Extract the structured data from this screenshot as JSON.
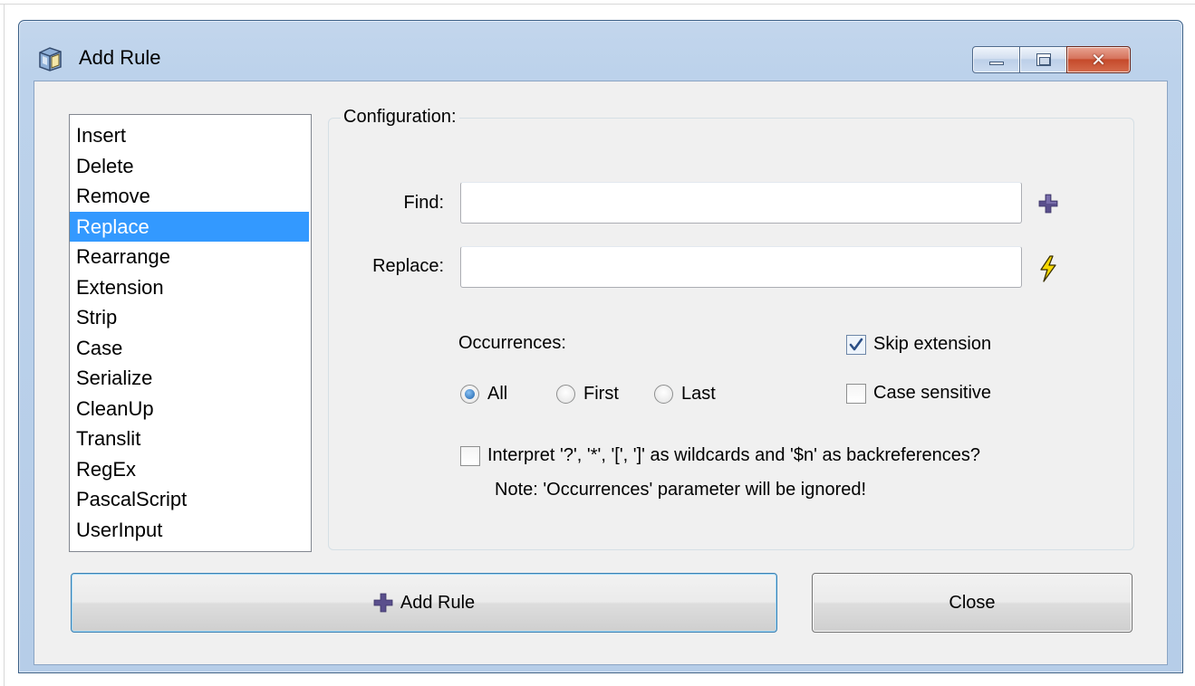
{
  "window": {
    "title": "Add Rule",
    "app_icon": "folder-rename-icon"
  },
  "titlebar_buttons": {
    "minimize_icon": "minimize-icon",
    "maximize_icon": "maximize-icon",
    "close_icon": "close-icon",
    "close_glyph": "✕"
  },
  "rules": {
    "items": [
      "Insert",
      "Delete",
      "Remove",
      "Replace",
      "Rearrange",
      "Extension",
      "Strip",
      "Case",
      "Serialize",
      "CleanUp",
      "Translit",
      "RegEx",
      "PascalScript",
      "UserInput"
    ],
    "selected": "Replace"
  },
  "config": {
    "legend": "Configuration:",
    "find_label": "Find:",
    "find_value": "",
    "replace_label": "Replace:",
    "replace_value": "",
    "find_side_icon": "plus-icon",
    "replace_side_icon": "lightning-icon",
    "occurrences_label": "Occurrences:",
    "occurrences": {
      "options": [
        "All",
        "First",
        "Last"
      ],
      "selected": "All"
    },
    "skip_extension": {
      "label": "Skip extension",
      "checked": true
    },
    "case_sensitive": {
      "label": "Case sensitive",
      "checked": false
    },
    "wildcards": {
      "label": "Interpret '?', '*', '[', ']' as wildcards and '$n' as backreferences?",
      "checked": false
    },
    "note": "Note: 'Occurrences' parameter will be ignored!"
  },
  "actions": {
    "add_rule_label": "Add Rule",
    "add_rule_icon": "plus-icon",
    "close_label": "Close"
  },
  "colors": {
    "selection": "#3399ff",
    "plus_icon": "#5a4f8c",
    "lightning_icon": "#f5d800"
  }
}
